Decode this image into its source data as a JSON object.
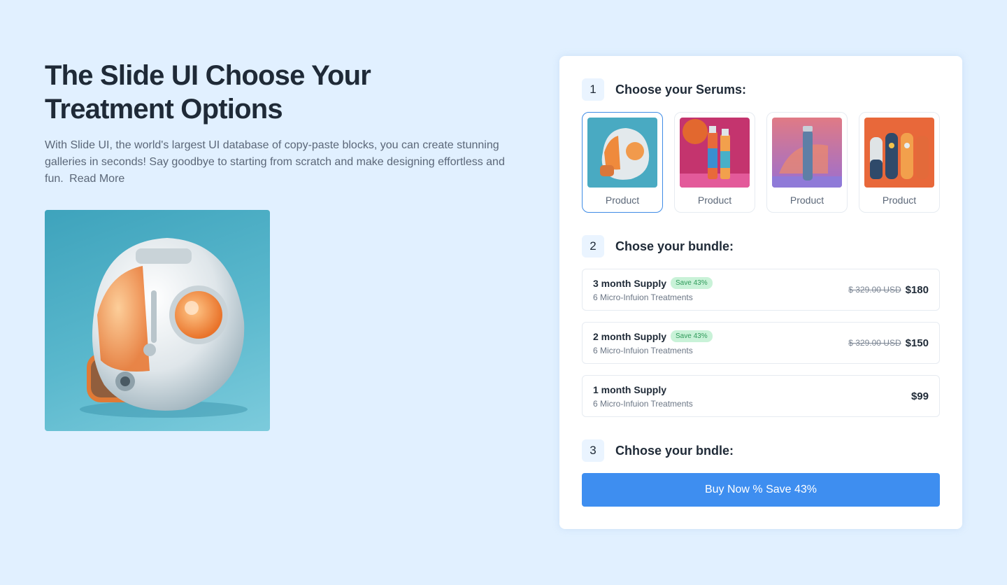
{
  "hero": {
    "title": "The Slide UI Choose Your Treatment Options",
    "description": "With Slide UI, the world's largest UI database of copy-paste blocks, you can create stunning galleries in seconds! Say goodbye to starting from scratch and make designing effortless and fun.",
    "read_more": "Read More"
  },
  "steps": [
    {
      "number": "1",
      "title": "Choose your Serums:"
    },
    {
      "number": "2",
      "title": "Chose your bundle:"
    },
    {
      "number": "3",
      "title": "Chhose your bndle:"
    }
  ],
  "products": [
    {
      "label": "Product",
      "selected": true
    },
    {
      "label": "Product",
      "selected": false
    },
    {
      "label": "Product",
      "selected": false
    },
    {
      "label": "Product",
      "selected": false
    }
  ],
  "bundles": [
    {
      "name": "3 month Supply",
      "badge": "Save 43%",
      "sub": "6 Micro-Infuion Treatments",
      "old_price": "$ 329.00 USD",
      "price": "$180"
    },
    {
      "name": "2 month Supply",
      "badge": "Save 43%",
      "sub": "6 Micro-Infuion Treatments",
      "old_price": "$ 329.00 USD",
      "price": "$150"
    },
    {
      "name": "1 month Supply",
      "sub": "6 Micro-Infuion Treatments",
      "price": "$99"
    }
  ],
  "cta": {
    "label": "Buy Now % Save 43%"
  },
  "colors": {
    "background": "#e1f0ff",
    "accent": "#3e8ef0",
    "badge_bg": "#c9f2d8",
    "badge_text": "#2f9a5a"
  }
}
